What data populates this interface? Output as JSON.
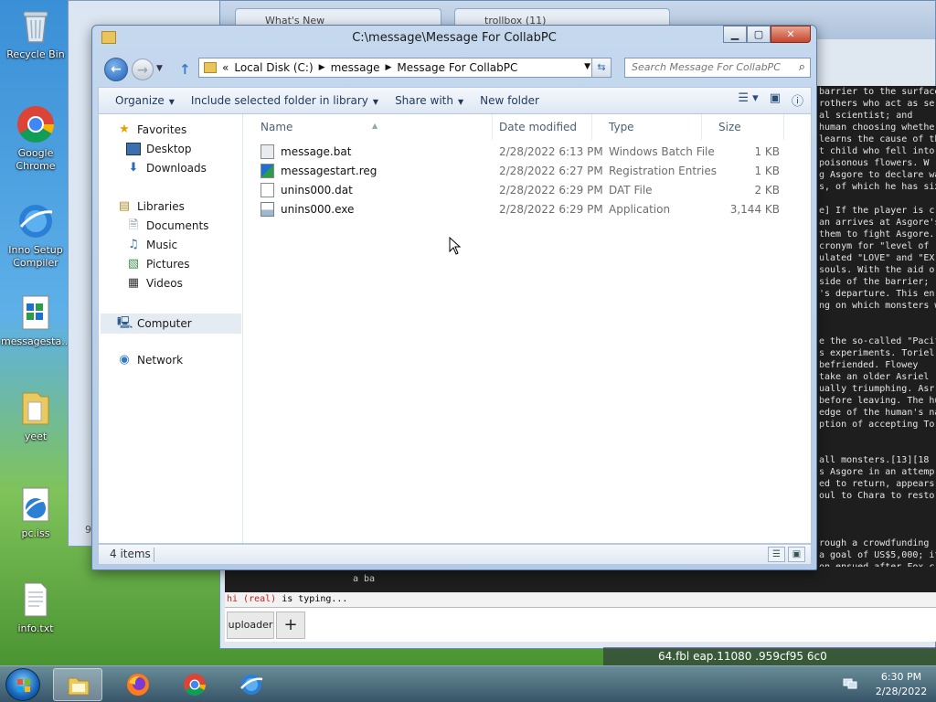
{
  "desktop": {
    "icons": [
      {
        "label": "Recycle Bin"
      },
      {
        "label": "Google Chrome"
      },
      {
        "label": "Inno Setup Compiler"
      },
      {
        "label": "messagesta..."
      },
      {
        "label": "yeet"
      },
      {
        "label": "pc.iss"
      },
      {
        "label": "info.txt"
      }
    ]
  },
  "background": {
    "tabs": [
      {
        "label": "What's New"
      },
      {
        "label": "trollbox (11)"
      }
    ],
    "console_lines": [
      "barrier to the surface",
      "rothers who act as ser",
      "al scientist; and",
      "human choosing whethe",
      "learns the cause of th",
      "t child who fell into",
      "poisonous flowers. W",
      "g Asgore to declare wa",
      "s, of which he has six",
      "",
      "e] If the player is c",
      "an arrives at Asgore's",
      "them to fight Asgore.",
      "cronym for \"level of",
      "ulated \"LOVE\" and \"EX",
      "souls. With the aid o",
      "side of the barrier;",
      "'s departure. This en",
      "ng on which monsters w",
      "",
      "",
      "e the so-called \"Pacif",
      "s experiments. Toriel",
      "befriended. Flowey",
      "take an older Asriel",
      "ually triumphing. Asr",
      "before leaving. The hu",
      "edge of the human's na",
      "ption of accepting Tor",
      "",
      "",
      "all monsters.[13][18",
      "s Asgore in an attemp",
      "ed to return, appears",
      "oul to Chara to restor",
      "",
      "",
      "",
      "rough a crowdfunding",
      "a goal of US$5,000; it",
      "on ensued after Fox cr"
    ],
    "chat_line": "a ba",
    "typing_user": "hi (real)",
    "typing_suffix": " is typing...",
    "uploader_label": "uploader",
    "plus_label": "+",
    "url_fragment": "64.fbl  eap.11080          .959cf95          6c0",
    "left_window_label": "9"
  },
  "explorer": {
    "title": "C:\\message\\Message For CollabPC",
    "window_buttons": {
      "minimize": "▁",
      "maximize": "▢",
      "close": "✕"
    },
    "address": {
      "overflow": "«",
      "segments": [
        "Local Disk (C:)",
        "message",
        "Message For CollabPC"
      ]
    },
    "search_placeholder": "Search Message For CollabPC",
    "toolbar": {
      "organize": "Organize",
      "include": "Include selected folder in library",
      "share": "Share with",
      "new_folder": "New folder"
    },
    "nav": {
      "favorites": "Favorites",
      "desktop": "Desktop",
      "downloads": "Downloads",
      "libraries": "Libraries",
      "documents": "Documents",
      "music": "Music",
      "pictures": "Pictures",
      "videos": "Videos",
      "computer": "Computer",
      "network": "Network"
    },
    "columns": {
      "name": "Name",
      "date": "Date modified",
      "type": "Type",
      "size": "Size"
    },
    "files": [
      {
        "name": "message.bat",
        "date": "2/28/2022 6:13 PM",
        "type": "Windows Batch File",
        "size": "1 KB"
      },
      {
        "name": "messagestart.reg",
        "date": "2/28/2022 6:27 PM",
        "type": "Registration Entries",
        "size": "1 KB"
      },
      {
        "name": "unins000.dat",
        "date": "2/28/2022 6:29 PM",
        "type": "DAT File",
        "size": "2 KB"
      },
      {
        "name": "unins000.exe",
        "date": "2/28/2022 6:29 PM",
        "type": "Application",
        "size": "3,144 KB"
      }
    ],
    "status": "4 items"
  },
  "taskbar": {
    "time": "6:30 PM",
    "date": "2/28/2022"
  }
}
